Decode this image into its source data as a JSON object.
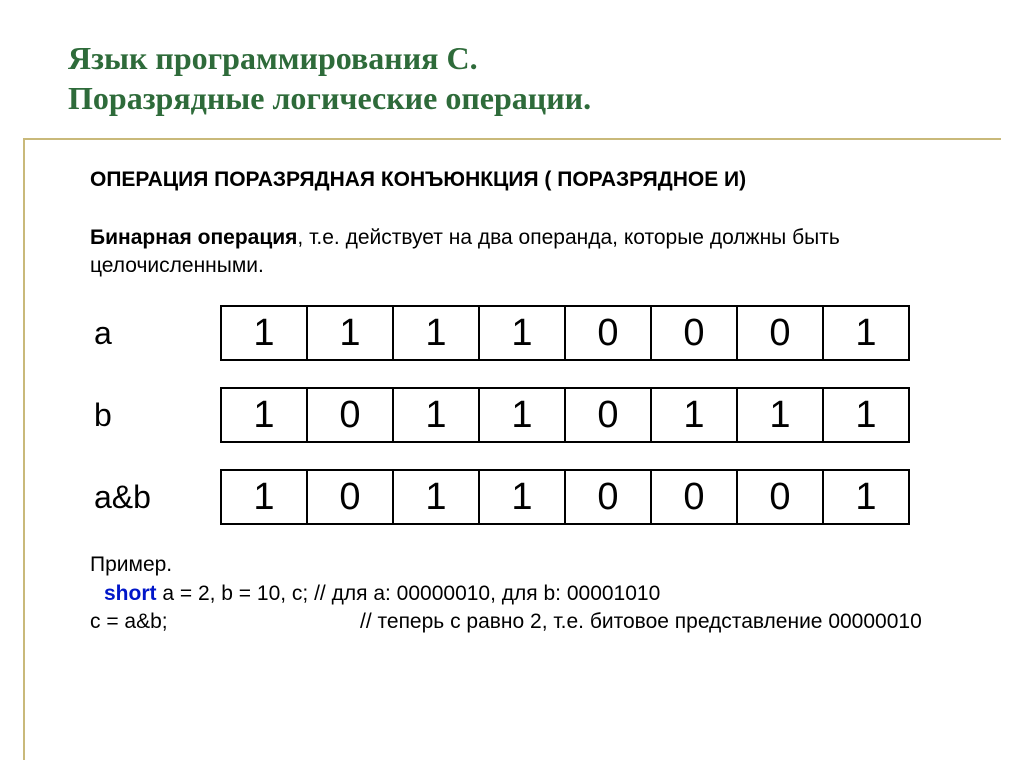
{
  "title_line1": "Язык программирования С.",
  "title_line2": " Поразрядные логические операции.",
  "heading": "ОПЕРАЦИЯ ПОРАЗРЯДНАЯ КОНЪЮНКЦИЯ ( ПОРАЗРЯДНОЕ И)",
  "para_bold": "Бинарная операция",
  "para_rest": ", т.е. действует на два операнда, которые должны быть целочисленными.",
  "rows": {
    "a": {
      "label": "a",
      "bits": [
        "1",
        "1",
        "1",
        "1",
        "0",
        "0",
        "0",
        "1"
      ]
    },
    "b": {
      "label": "b",
      "bits": [
        "1",
        "0",
        "1",
        "1",
        "0",
        "1",
        "1",
        "1"
      ]
    },
    "and": {
      "label": "a&b",
      "bits": [
        "1",
        "0",
        "1",
        "1",
        "0",
        "0",
        "0",
        "1"
      ]
    }
  },
  "example": {
    "title": "Пример.",
    "kw": "short",
    "decl": " a = 2, b = 10, c; // для а: 00000010, для b: 00001010",
    "assign_lhs": " c = a&b;",
    "assign_rhs": "// теперь с равно 2, т.е. битовое представление 00000010"
  }
}
